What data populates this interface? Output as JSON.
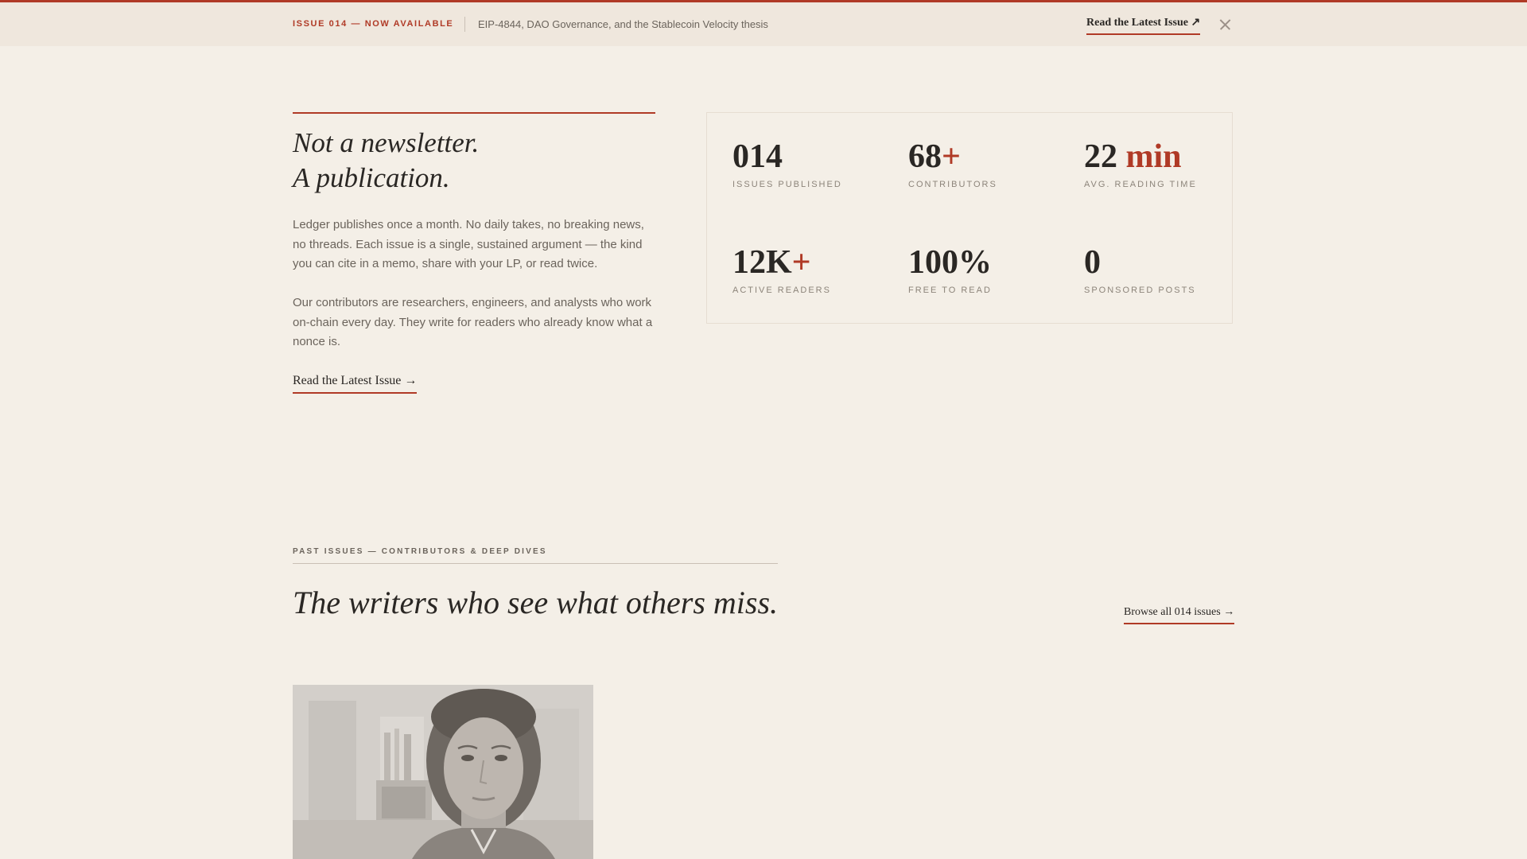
{
  "banner": {
    "tag": "ISSUE 014 — NOW AVAILABLE",
    "description": "EIP-4844, DAO Governance, and the Stablecoin Velocity thesis",
    "cta_label": "Read the Latest Issue ↗"
  },
  "intro": {
    "title_line_1": "Not a newsletter.",
    "title_line_2": "A publication.",
    "paragraph_1": "Ledger publishes once a month. No daily takes, no breaking news, no threads. Each issue is a single, sustained argument — the kind you can cite in a memo, share with your LP, or read twice.",
    "paragraph_2": "Our contributors are researchers, engineers, and analysts who work on-chain every day. They write for readers who already know what a nonce is.",
    "cta_label": "Read the Latest Issue →"
  },
  "stats": [
    {
      "value": "014",
      "accent": "",
      "label": "ISSUES PUBLISHED"
    },
    {
      "value": "68",
      "accent": "+",
      "label": "CONTRIBUTORS"
    },
    {
      "value": "22 ",
      "accent": "min",
      "label": "AVG. READING TIME"
    },
    {
      "value": "12K",
      "accent": "+",
      "label": "ACTIVE READERS"
    },
    {
      "value": "100%",
      "accent": "",
      "label": "FREE TO READ"
    },
    {
      "value": "0",
      "accent": "",
      "label": "SPONSORED POSTS"
    }
  ],
  "past_issues": {
    "kicker": "PAST ISSUES — CONTRIBUTORS & DEEP DIVES",
    "title": "The writers who see what others miss.",
    "browse_label": "Browse all 014 issues →"
  },
  "colors": {
    "accent": "#b03a26",
    "background": "#f4efe7",
    "banner_background": "#efe7dd",
    "ink": "#2a2724"
  }
}
